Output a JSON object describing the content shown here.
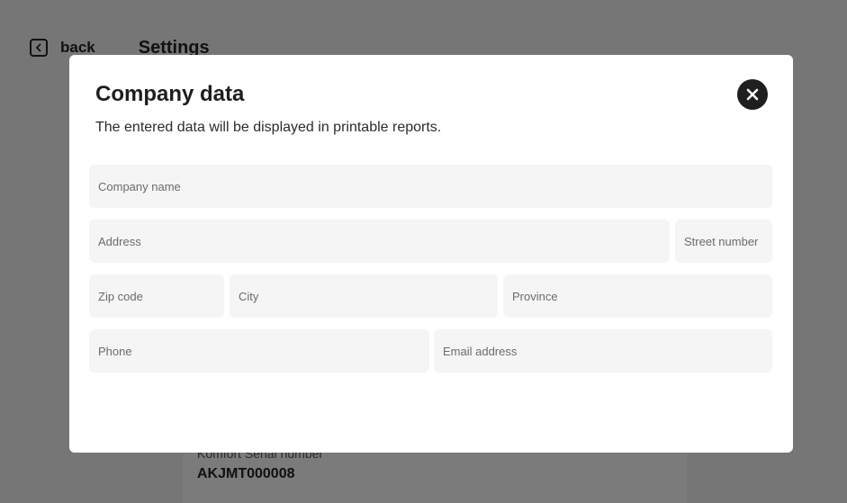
{
  "background": {
    "back_label": "back",
    "title": "Settings",
    "serial_label": "Komfort Serial number",
    "serial_value": "AKJMT000008"
  },
  "modal": {
    "title": "Company data",
    "subtitle": "The entered data will be displayed in printable reports.",
    "fields": {
      "company_name": "Company name",
      "address": "Address",
      "street_number": "Street number",
      "zip_code": "Zip code",
      "city": "City",
      "province": "Province",
      "phone": "Phone",
      "email": "Email address"
    }
  }
}
